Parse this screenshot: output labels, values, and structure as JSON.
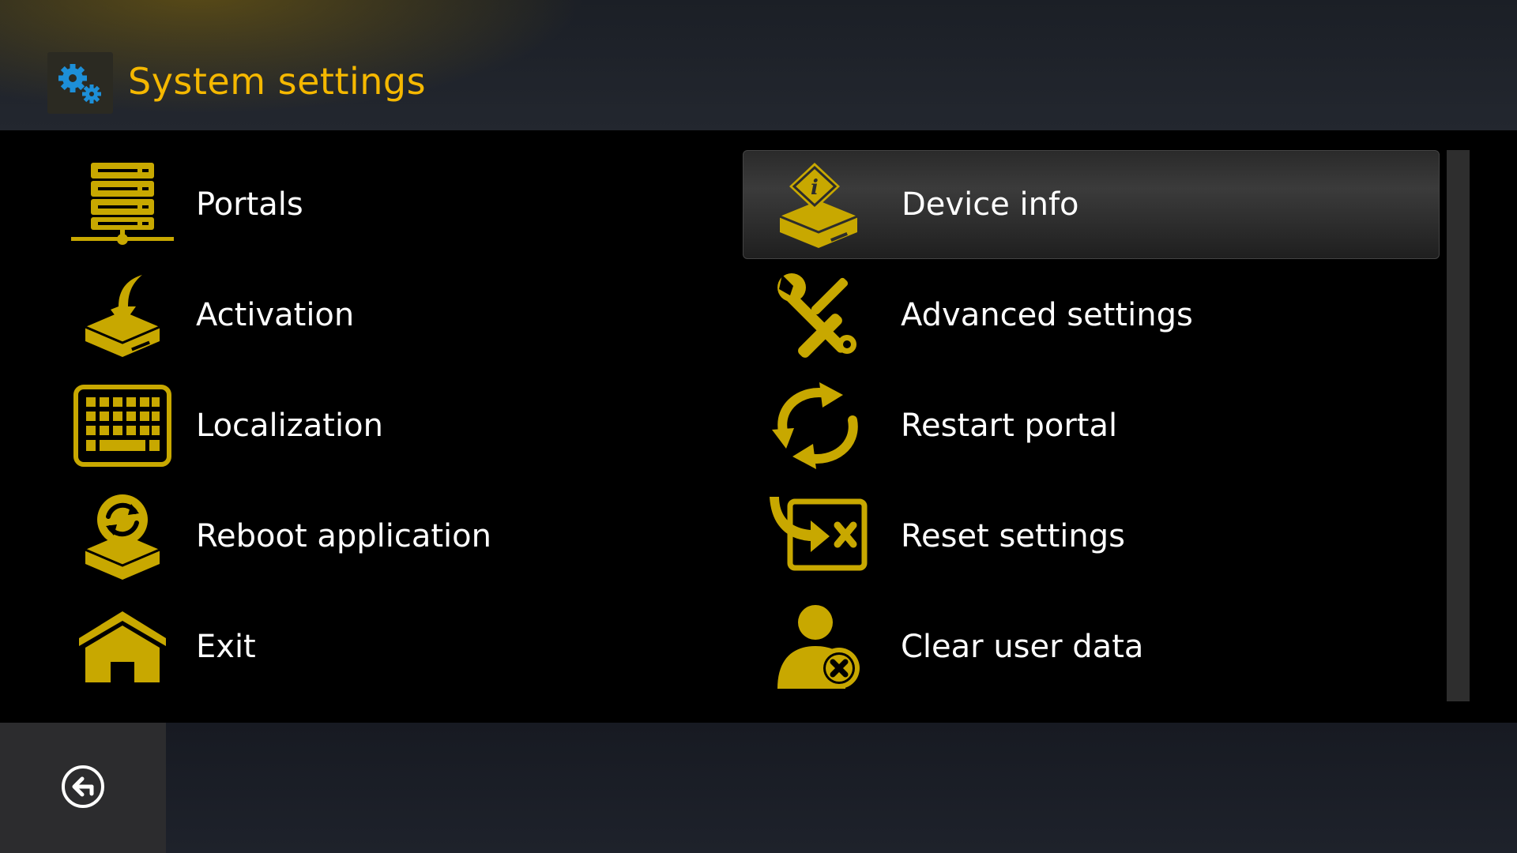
{
  "header": {
    "title": "System settings",
    "icon": "gears-icon"
  },
  "menu": {
    "left": [
      {
        "label": "Portals",
        "icon": "server-icon"
      },
      {
        "label": "Activation",
        "icon": "activation-icon"
      },
      {
        "label": "Localization",
        "icon": "keyboard-icon"
      },
      {
        "label": "Reboot application",
        "icon": "reboot-icon"
      },
      {
        "label": "Exit",
        "icon": "home-icon"
      }
    ],
    "right": [
      {
        "label": "Device info",
        "icon": "device-info-icon",
        "selected": true
      },
      {
        "label": "Advanced settings",
        "icon": "tools-icon"
      },
      {
        "label": "Restart portal",
        "icon": "restart-icon"
      },
      {
        "label": "Reset settings",
        "icon": "reset-icon"
      },
      {
        "label": "Clear user data",
        "icon": "clear-user-icon"
      }
    ]
  },
  "footer": {
    "back_icon": "back-icon"
  },
  "colors": {
    "accent": "#f5b800",
    "icon": "#c8a800",
    "background": "#000000"
  }
}
